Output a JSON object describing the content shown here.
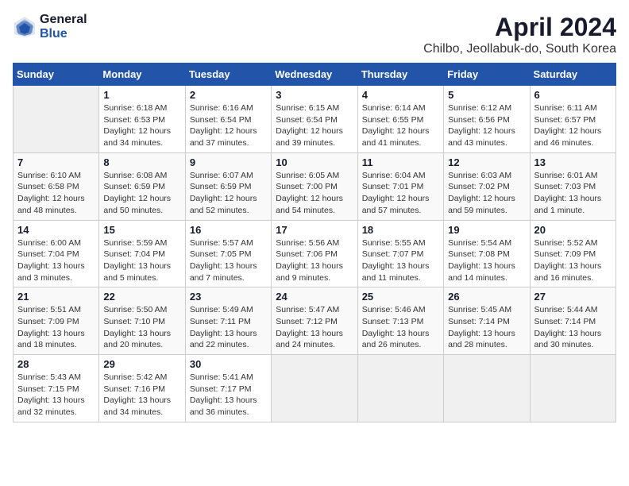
{
  "header": {
    "logo_general": "General",
    "logo_blue": "Blue",
    "title": "April 2024",
    "subtitle": "Chilbo, Jeollabuk-do, South Korea"
  },
  "calendar": {
    "days_of_week": [
      "Sunday",
      "Monday",
      "Tuesday",
      "Wednesday",
      "Thursday",
      "Friday",
      "Saturday"
    ],
    "weeks": [
      [
        {
          "day": "",
          "info": ""
        },
        {
          "day": "1",
          "info": "Sunrise: 6:18 AM\nSunset: 6:53 PM\nDaylight: 12 hours\nand 34 minutes."
        },
        {
          "day": "2",
          "info": "Sunrise: 6:16 AM\nSunset: 6:54 PM\nDaylight: 12 hours\nand 37 minutes."
        },
        {
          "day": "3",
          "info": "Sunrise: 6:15 AM\nSunset: 6:54 PM\nDaylight: 12 hours\nand 39 minutes."
        },
        {
          "day": "4",
          "info": "Sunrise: 6:14 AM\nSunset: 6:55 PM\nDaylight: 12 hours\nand 41 minutes."
        },
        {
          "day": "5",
          "info": "Sunrise: 6:12 AM\nSunset: 6:56 PM\nDaylight: 12 hours\nand 43 minutes."
        },
        {
          "day": "6",
          "info": "Sunrise: 6:11 AM\nSunset: 6:57 PM\nDaylight: 12 hours\nand 46 minutes."
        }
      ],
      [
        {
          "day": "7",
          "info": "Sunrise: 6:10 AM\nSunset: 6:58 PM\nDaylight: 12 hours\nand 48 minutes."
        },
        {
          "day": "8",
          "info": "Sunrise: 6:08 AM\nSunset: 6:59 PM\nDaylight: 12 hours\nand 50 minutes."
        },
        {
          "day": "9",
          "info": "Sunrise: 6:07 AM\nSunset: 6:59 PM\nDaylight: 12 hours\nand 52 minutes."
        },
        {
          "day": "10",
          "info": "Sunrise: 6:05 AM\nSunset: 7:00 PM\nDaylight: 12 hours\nand 54 minutes."
        },
        {
          "day": "11",
          "info": "Sunrise: 6:04 AM\nSunset: 7:01 PM\nDaylight: 12 hours\nand 57 minutes."
        },
        {
          "day": "12",
          "info": "Sunrise: 6:03 AM\nSunset: 7:02 PM\nDaylight: 12 hours\nand 59 minutes."
        },
        {
          "day": "13",
          "info": "Sunrise: 6:01 AM\nSunset: 7:03 PM\nDaylight: 13 hours\nand 1 minute."
        }
      ],
      [
        {
          "day": "14",
          "info": "Sunrise: 6:00 AM\nSunset: 7:04 PM\nDaylight: 13 hours\nand 3 minutes."
        },
        {
          "day": "15",
          "info": "Sunrise: 5:59 AM\nSunset: 7:04 PM\nDaylight: 13 hours\nand 5 minutes."
        },
        {
          "day": "16",
          "info": "Sunrise: 5:57 AM\nSunset: 7:05 PM\nDaylight: 13 hours\nand 7 minutes."
        },
        {
          "day": "17",
          "info": "Sunrise: 5:56 AM\nSunset: 7:06 PM\nDaylight: 13 hours\nand 9 minutes."
        },
        {
          "day": "18",
          "info": "Sunrise: 5:55 AM\nSunset: 7:07 PM\nDaylight: 13 hours\nand 11 minutes."
        },
        {
          "day": "19",
          "info": "Sunrise: 5:54 AM\nSunset: 7:08 PM\nDaylight: 13 hours\nand 14 minutes."
        },
        {
          "day": "20",
          "info": "Sunrise: 5:52 AM\nSunset: 7:09 PM\nDaylight: 13 hours\nand 16 minutes."
        }
      ],
      [
        {
          "day": "21",
          "info": "Sunrise: 5:51 AM\nSunset: 7:09 PM\nDaylight: 13 hours\nand 18 minutes."
        },
        {
          "day": "22",
          "info": "Sunrise: 5:50 AM\nSunset: 7:10 PM\nDaylight: 13 hours\nand 20 minutes."
        },
        {
          "day": "23",
          "info": "Sunrise: 5:49 AM\nSunset: 7:11 PM\nDaylight: 13 hours\nand 22 minutes."
        },
        {
          "day": "24",
          "info": "Sunrise: 5:47 AM\nSunset: 7:12 PM\nDaylight: 13 hours\nand 24 minutes."
        },
        {
          "day": "25",
          "info": "Sunrise: 5:46 AM\nSunset: 7:13 PM\nDaylight: 13 hours\nand 26 minutes."
        },
        {
          "day": "26",
          "info": "Sunrise: 5:45 AM\nSunset: 7:14 PM\nDaylight: 13 hours\nand 28 minutes."
        },
        {
          "day": "27",
          "info": "Sunrise: 5:44 AM\nSunset: 7:14 PM\nDaylight: 13 hours\nand 30 minutes."
        }
      ],
      [
        {
          "day": "28",
          "info": "Sunrise: 5:43 AM\nSunset: 7:15 PM\nDaylight: 13 hours\nand 32 minutes."
        },
        {
          "day": "29",
          "info": "Sunrise: 5:42 AM\nSunset: 7:16 PM\nDaylight: 13 hours\nand 34 minutes."
        },
        {
          "day": "30",
          "info": "Sunrise: 5:41 AM\nSunset: 7:17 PM\nDaylight: 13 hours\nand 36 minutes."
        },
        {
          "day": "",
          "info": ""
        },
        {
          "day": "",
          "info": ""
        },
        {
          "day": "",
          "info": ""
        },
        {
          "day": "",
          "info": ""
        }
      ]
    ]
  }
}
